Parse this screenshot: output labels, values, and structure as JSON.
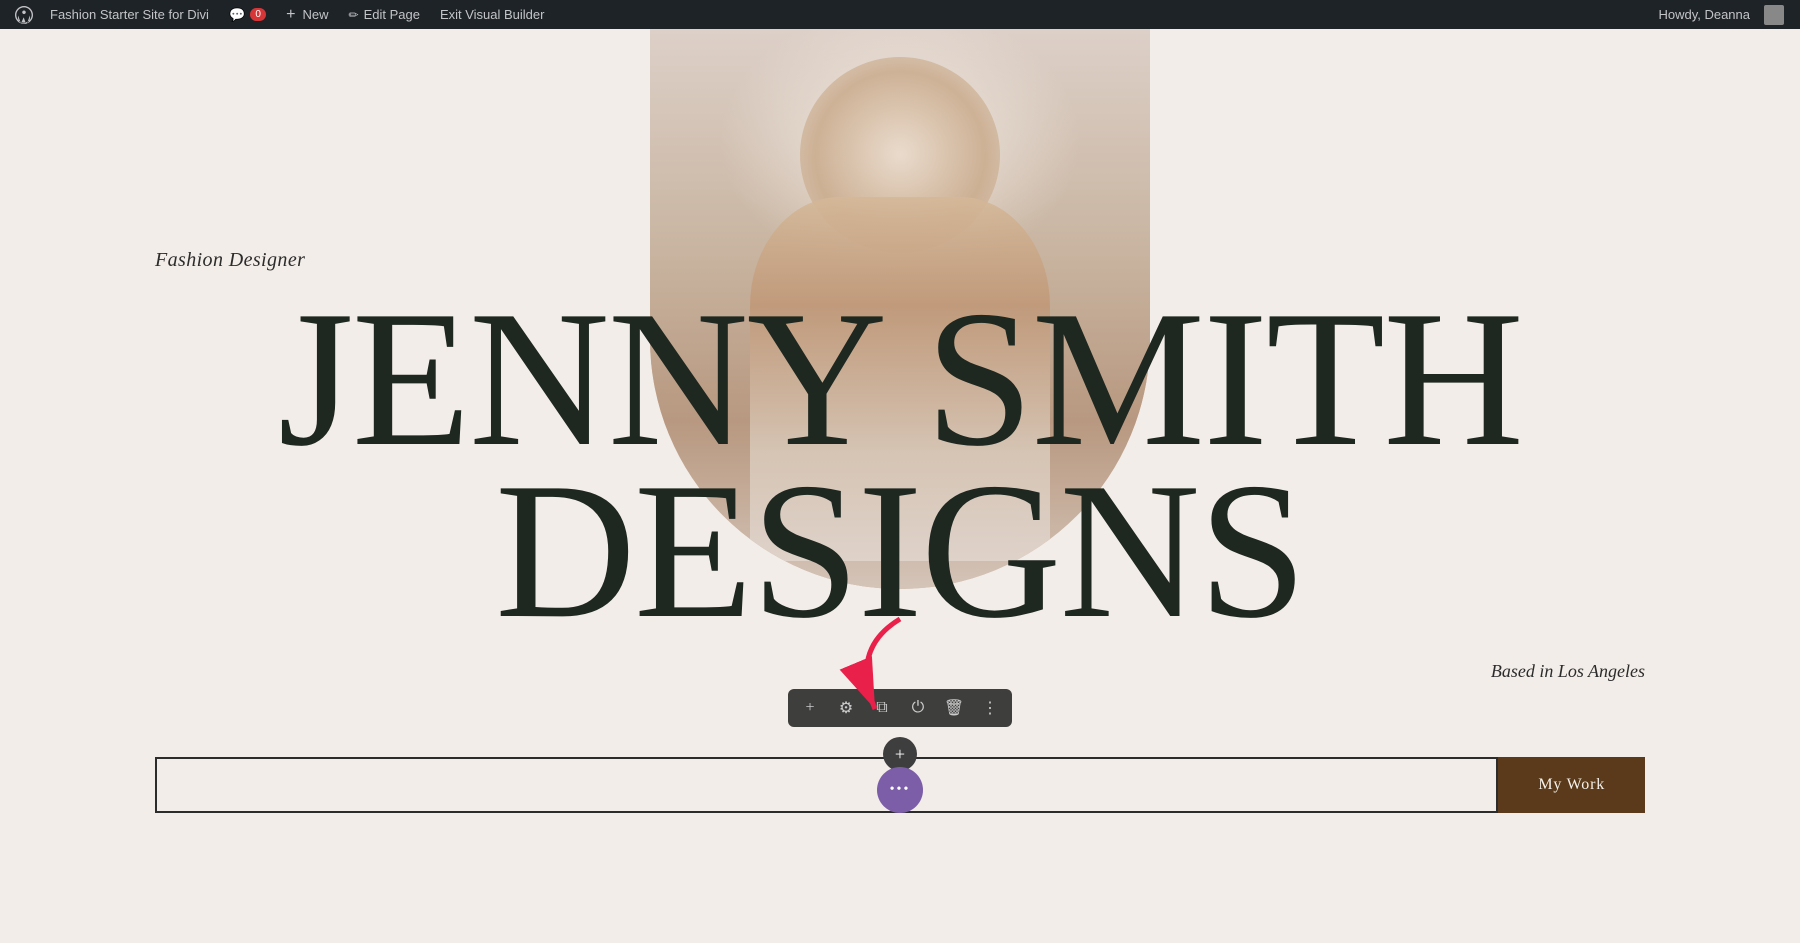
{
  "adminBar": {
    "siteName": "Fashion Starter Site for Divi",
    "commentCount": "0",
    "newLabel": "New",
    "editPageLabel": "Edit Page",
    "exitBuilderLabel": "Exit Visual Builder",
    "howdyLabel": "Howdy, Deanna"
  },
  "hero": {
    "fashionDesignerLabel": "Fashion Designer",
    "titleLine1": "JENNY SMITH",
    "titleLine2": "DESIGNS",
    "basedInLabel": "Based in Los Angeles"
  },
  "inputRow": {
    "placeholder": "",
    "myWorkLabel": "My Work"
  },
  "diviToolbar": {
    "addIcon": "+",
    "settingsIcon": "⚙",
    "duplicateIcon": "⧉",
    "disableIcon": "⏻",
    "deleteIcon": "🗑",
    "moreIcon": "⋮"
  }
}
